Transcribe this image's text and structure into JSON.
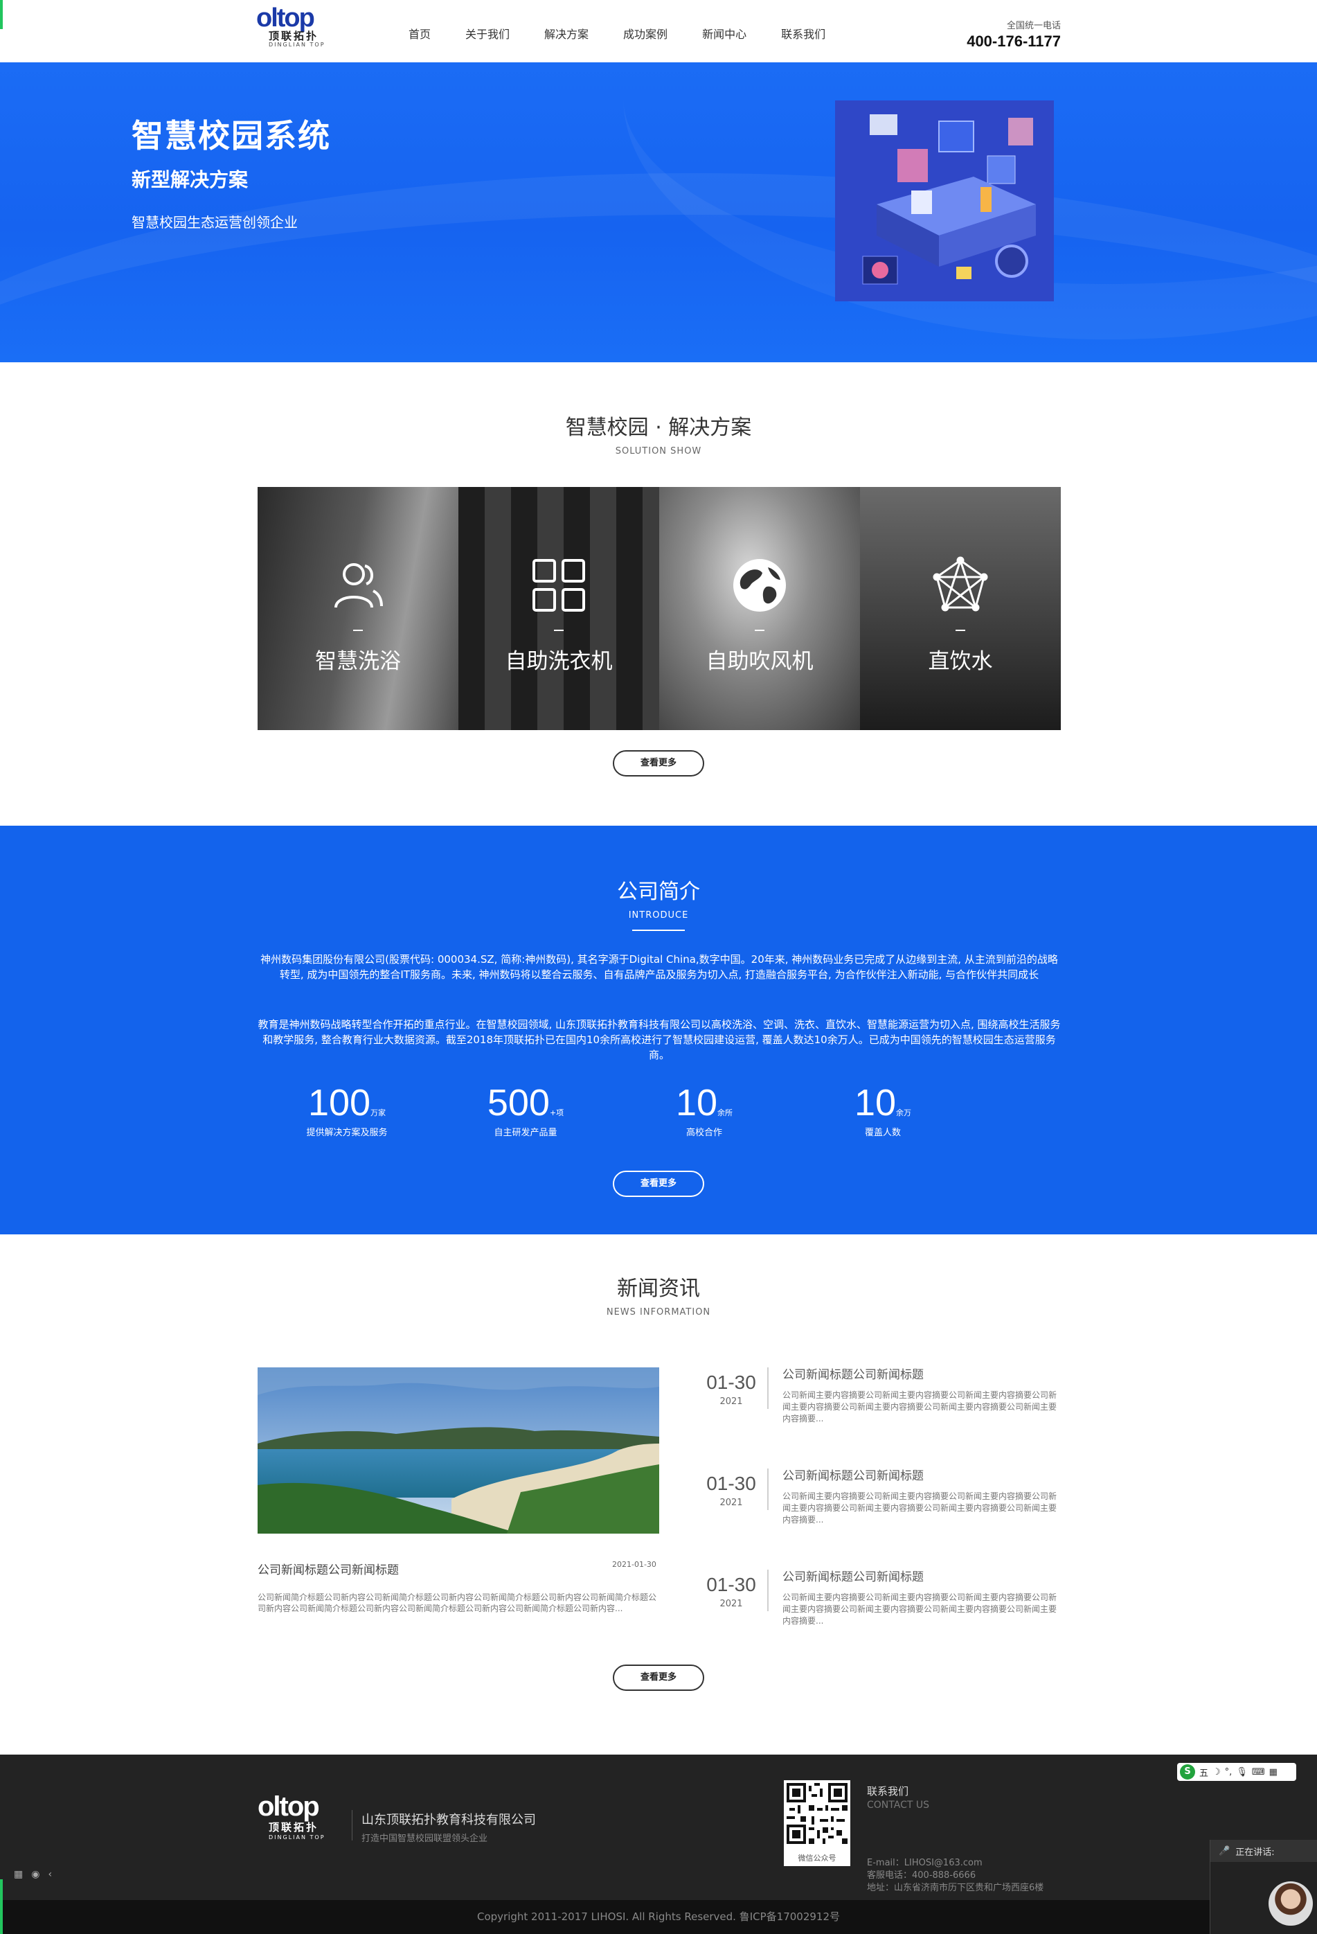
{
  "header": {
    "logo_mark": "oltop",
    "logo_cn": "顶联拓扑",
    "logo_en": "DINGLIAN TOP",
    "nav": [
      "首页",
      "关于我们",
      "解决方案",
      "成功案例",
      "新闻中心",
      "联系我们"
    ],
    "hotline_label": "全国统一电话",
    "hotline": "400-176-1177"
  },
  "hero": {
    "title": "智慧校园系统",
    "subtitle": "新型解决方案",
    "tagline": "智慧校园生态运营创领企业"
  },
  "solutions": {
    "title": "智慧校园 · 解决方案",
    "subtitle": "SOLUTION SHOW",
    "items": [
      {
        "label": "智慧洗浴",
        "icon": "users-icon"
      },
      {
        "label": "自助洗衣机",
        "icon": "grid-icon"
      },
      {
        "label": "自助吹风机",
        "icon": "globe-icon"
      },
      {
        "label": "直饮水",
        "icon": "network-icon"
      }
    ],
    "more": "查看更多"
  },
  "intro": {
    "title": "公司简介",
    "subtitle": "INTRODUCE",
    "para1": "神州数码集团股份有限公司(股票代码: 000034.SZ, 简称:神州数码), 其名字源于Digital China,数字中国。20年来, 神州数码业务已完成了从边缘到主流, 从主流到前沿的战略转型, 成为中国领先的整合IT服务商。未来, 神州数码将以整合云服务、自有品牌产品及服务为切入点, 打造融合服务平台, 为合作伙伴注入新动能, 与合作伙伴共同成长",
    "para2": "教育是神州数码战略转型合作开拓的重点行业。在智慧校园领域, 山东顶联拓扑教育科技有限公司以高校洗浴、空调、洗衣、直饮水、智慧能源运营为切入点, 围绕高校生活服务和教学服务, 整合教育行业大数据资源。截至2018年顶联拓扑已在国内10余所高校进行了智慧校园建设运营, 覆盖人数达10余万人。已成为中国领先的智慧校园生态运营服务商。",
    "stats": [
      {
        "value": "100",
        "unit": "万家",
        "label": "提供解决方案及服务"
      },
      {
        "value": "500",
        "unit": "+项",
        "label": "自主研发产品量"
      },
      {
        "value": "10",
        "unit": "余所",
        "label": "高校合作"
      },
      {
        "value": "10",
        "unit": "余万",
        "label": "覆盖人数"
      }
    ],
    "more": "查看更多"
  },
  "news": {
    "title": "新闻资讯",
    "subtitle": "NEWS INFORMATION",
    "feature": {
      "title": "公司新闻标题公司新闻标题",
      "date": "2021-01-30",
      "body": "公司新闻简介标题公司新内容公司新闻简介标题公司新内容公司新闻简介标题公司新内容公司新闻简介标题公司新内容公司新闻简介标题公司新内容公司新闻简介标题公司新内容公司新闻简介标题公司新内容..."
    },
    "items": [
      {
        "md": "01-30",
        "year": "2021",
        "title": "公司新闻标题公司新闻标题",
        "body": "公司新闻主要内容摘要公司新闻主要内容摘要公司新闻主要内容摘要公司新闻主要内容摘要公司新闻主要内容摘要公司新闻主要内容摘要公司新闻主要内容摘要..."
      },
      {
        "md": "01-30",
        "year": "2021",
        "title": "公司新闻标题公司新闻标题",
        "body": "公司新闻主要内容摘要公司新闻主要内容摘要公司新闻主要内容摘要公司新闻主要内容摘要公司新闻主要内容摘要公司新闻主要内容摘要公司新闻主要内容摘要..."
      },
      {
        "md": "01-30",
        "year": "2021",
        "title": "公司新闻标题公司新闻标题",
        "body": "公司新闻主要内容摘要公司新闻主要内容摘要公司新闻主要内容摘要公司新闻主要内容摘要公司新闻主要内容摘要公司新闻主要内容摘要公司新闻主要内容摘要..."
      }
    ],
    "more": "查看更多"
  },
  "footer": {
    "logo_mark": "oltop",
    "logo_cn": "顶联拓扑",
    "logo_en": "DINGLIAN TOP",
    "company": "山东顶联拓扑教育科技有限公司",
    "slogan": "打造中国智慧校园联盟领头企业",
    "qr_caption": "微信公众号",
    "contact_title": "联系我们",
    "contact_en": "CONTACT US",
    "email": "E-mail：LIHOSI@163.com",
    "phone": "客服电话：400-888-6666",
    "address": "地址：山东省济南市历下区贵和广场西座6楼",
    "copyright": "Copyright 2011-2017 LIHOSI. All Rights Reserved. 鲁ICP备17002912号"
  },
  "widgets": {
    "ime_letter": "S",
    "ime_mode": "五",
    "talk_label": "正在讲话:"
  }
}
